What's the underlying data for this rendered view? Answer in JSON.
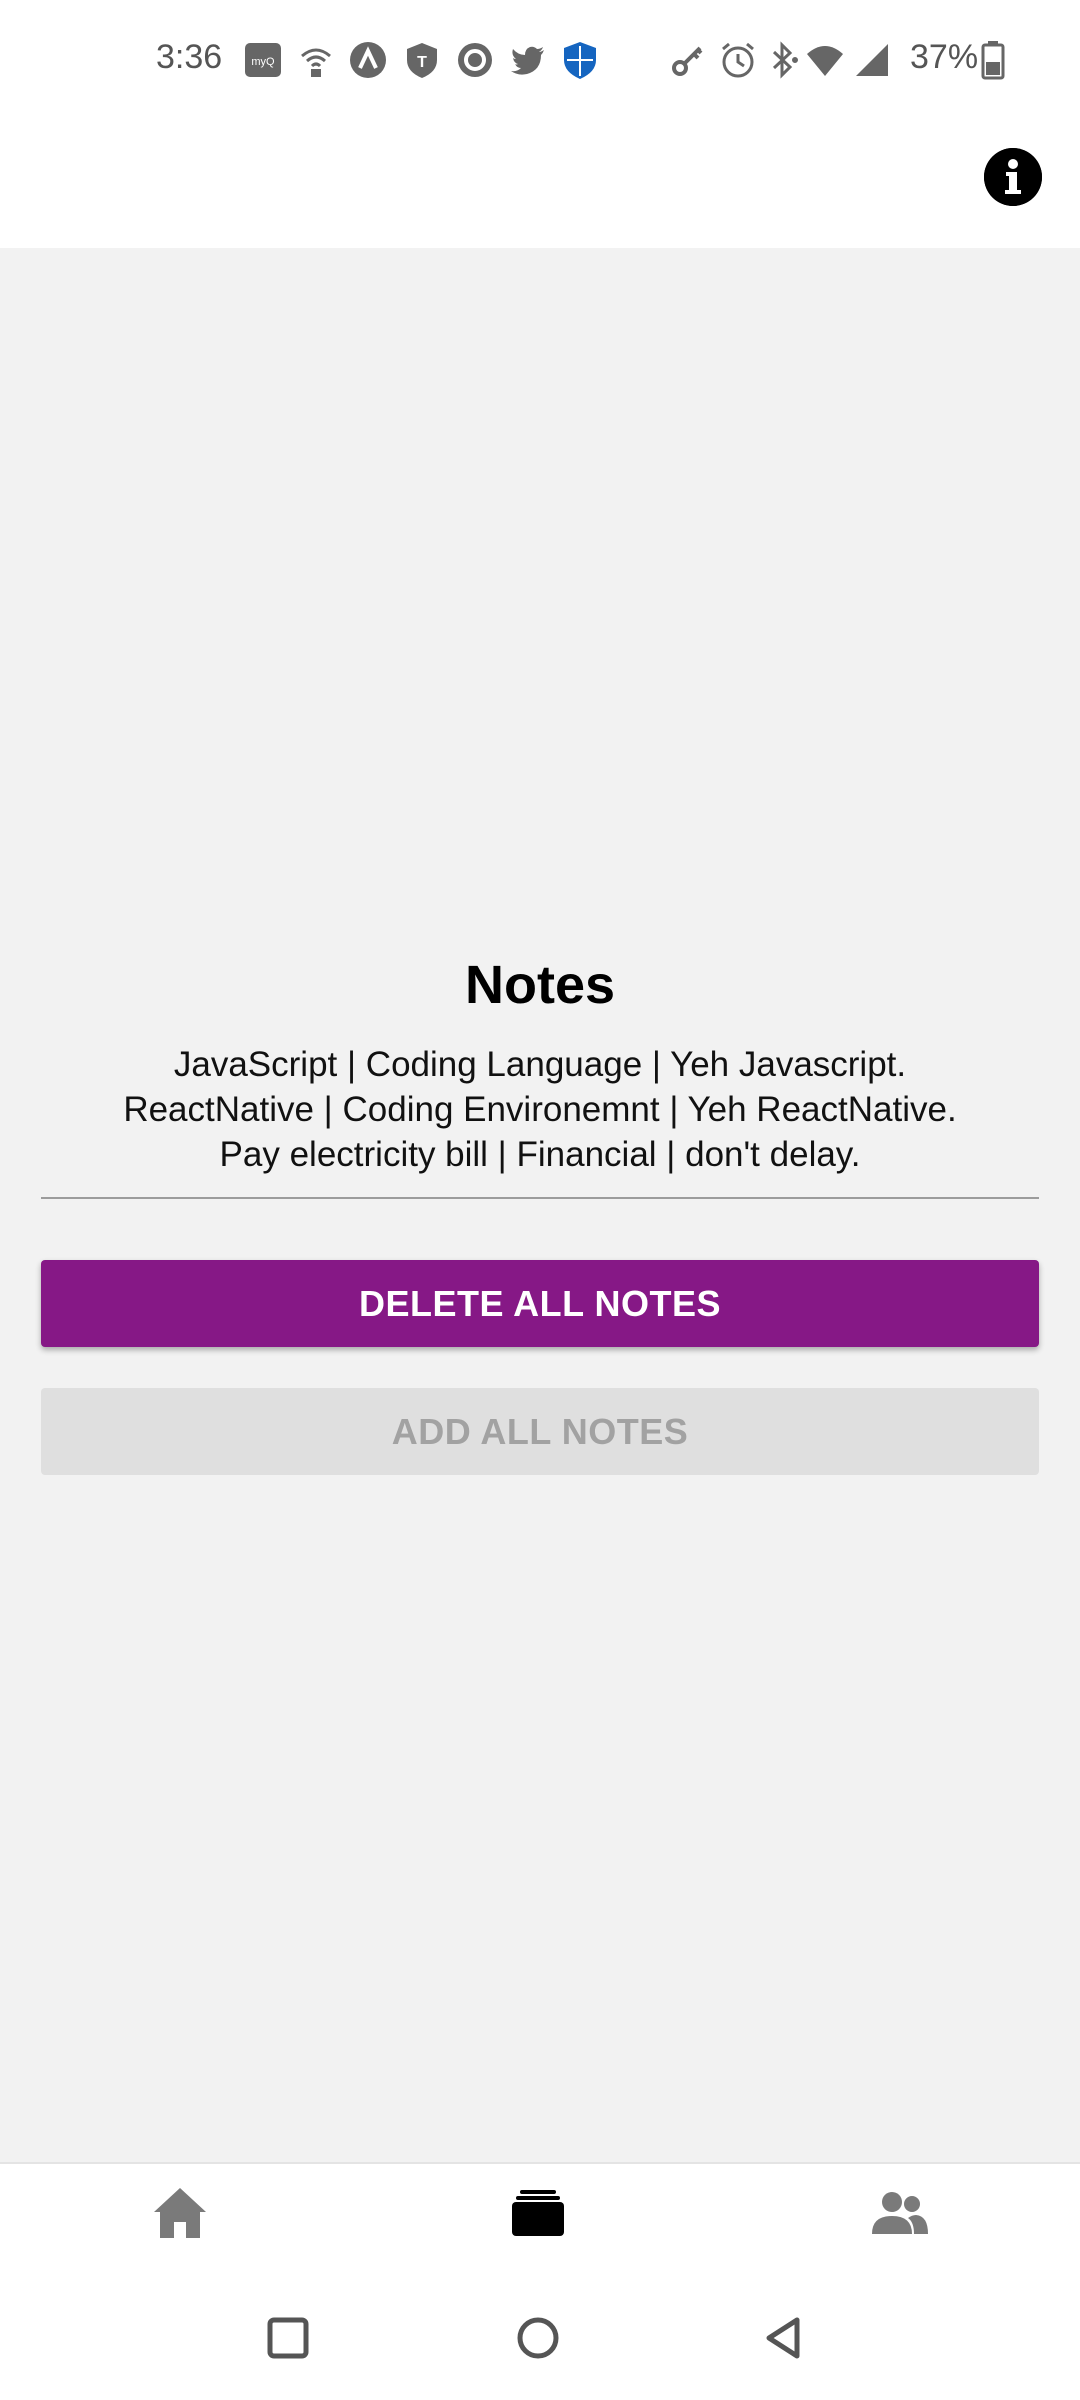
{
  "status_bar": {
    "time": "3:36",
    "battery": "37%",
    "icons": [
      "myq-icon",
      "wifi-calling-icon",
      "app-a-icon",
      "tmobile-shield-icon",
      "circle-app-icon",
      "twitter-icon",
      "shield-security-icon",
      "key-icon",
      "alarm-icon",
      "bluetooth-icon",
      "wifi-icon",
      "cell-signal-icon",
      "battery-icon"
    ]
  },
  "header": {
    "info_icon": "info-icon"
  },
  "notes": {
    "title": "Notes",
    "items": [
      "JavaScript | Coding Language | Yeh Javascript.",
      "ReactNative | Coding Environemnt | Yeh ReactNative.",
      "Pay electricity bill | Financial | don't delay."
    ]
  },
  "buttons": {
    "delete_all": "DELETE ALL NOTES",
    "add_all": "ADD ALL NOTES"
  },
  "tabs": [
    {
      "name": "home",
      "icon": "home-icon",
      "active": false
    },
    {
      "name": "notes",
      "icon": "cards-icon",
      "active": true
    },
    {
      "name": "people",
      "icon": "people-icon",
      "active": false
    }
  ],
  "colors": {
    "accent": "#861886",
    "disabled_bg": "#dfdfdf",
    "disabled_text": "#a2a2a2",
    "content_bg": "#f2f2f2"
  }
}
